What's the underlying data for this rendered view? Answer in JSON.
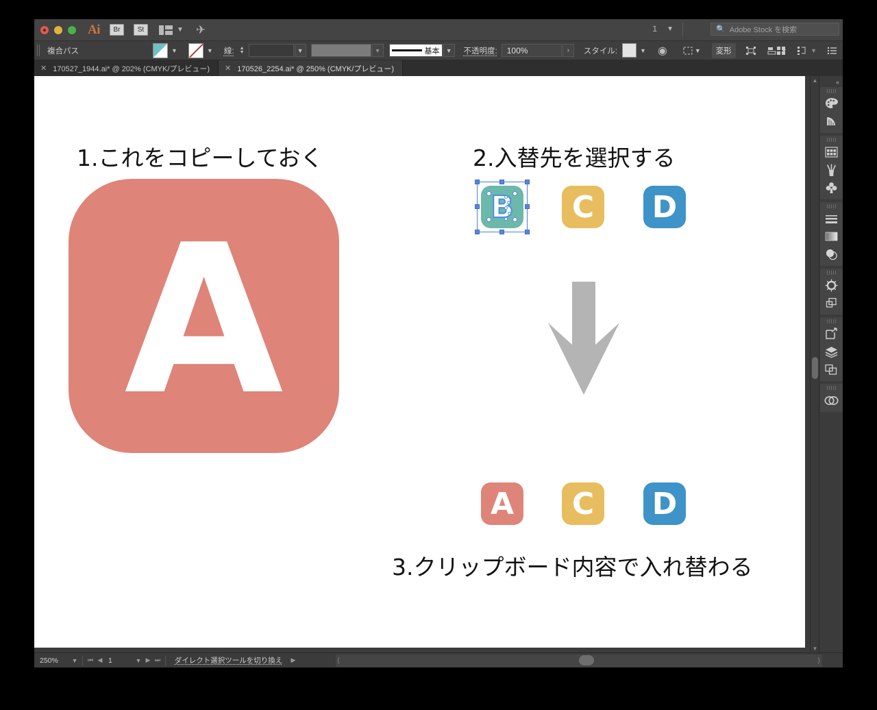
{
  "window": {
    "app_name": "Ai",
    "traffic_lights": [
      "close",
      "minimize",
      "zoom"
    ],
    "bridge_label": "Br",
    "stock_label": "St",
    "arrange_icon": "arrange-documents-icon",
    "sync_icon": "sync-settings-icon",
    "doc_count": "1",
    "search_placeholder": "Adobe Stock を検索",
    "search_icon": "search-icon"
  },
  "control_bar": {
    "object_type": "複合パス",
    "fill_label": "fill-swatch",
    "fill_color": "#6fc0c7",
    "stroke_swatch_label": "stroke-none-swatch",
    "stroke_label": "線:",
    "stroke_weight": "",
    "stroke_profile": "",
    "brush_definition": "基本",
    "opacity_label": "不透明度:",
    "opacity_value": "100%",
    "style_label": "スタイル:",
    "globe_icon": "recolor-artwork-icon",
    "select_similar_icon": "select-similar-icon",
    "transform_label": "変形",
    "isolate_icon": "isolate-group-icon",
    "align_icon": "align-objects-icon",
    "align_grid_icon": "align-grid-icon",
    "distribute_icon": "distribute-icon",
    "options_icon": "panel-options-icon"
  },
  "tabs": [
    {
      "title": "170527_1944.ai* @ 202% (CMYK/プレビュー)",
      "active": false,
      "close_icon": "close-tab-icon"
    },
    {
      "title": "170526_2254.ai* @ 250% (CMYK/プレビュー)",
      "active": true,
      "close_icon": "close-tab-icon"
    }
  ],
  "canvas": {
    "steps": {
      "step1": "1.これをコピーしておく",
      "step2": "2.入替先を選択する",
      "step3": "3.クリップボード内容で入れ替わる"
    },
    "source_tile": {
      "letter": "A",
      "color": "#de8479"
    },
    "target_row": [
      {
        "letter": "B",
        "color": "#6cb8ab",
        "selected": true
      },
      {
        "letter": "C",
        "color": "#e8bd5f",
        "selected": false
      },
      {
        "letter": "D",
        "color": "#3e93c8",
        "selected": false
      }
    ],
    "result_row": [
      {
        "letter": "A",
        "color": "#de8479",
        "selected": false
      },
      {
        "letter": "C",
        "color": "#e8bd5f",
        "selected": false
      },
      {
        "letter": "D",
        "color": "#3e93c8",
        "selected": false
      }
    ],
    "arrow_icon": "down-arrow-icon",
    "arrow_color": "#b4b4b4",
    "selection_color": "#5a86d8"
  },
  "panel_dock": {
    "collapse_icon": "collapse-panels-icon",
    "groups": [
      {
        "icons": [
          "color-icon",
          "color-guide-icon"
        ]
      },
      {
        "icons": [
          "swatches-icon",
          "brushes-icon",
          "symbols-icon"
        ]
      },
      {
        "icons": [
          "stroke-icon",
          "gradient-icon",
          "transparency-icon"
        ]
      },
      {
        "icons": [
          "appearance-icon",
          "graphic-styles-icon"
        ]
      },
      {
        "icons": [
          "artboards-icon",
          "layers-icon",
          "links-icon"
        ]
      },
      {
        "icons": [
          "creative-cloud-libraries-icon"
        ]
      }
    ]
  },
  "status_bar": {
    "zoom_level": "250%",
    "zoom_dropdown_icon": "chevron-down-icon",
    "first_page_icon": "first-page-icon",
    "prev_page_icon": "prev-page-icon",
    "page_number": "1",
    "page_dropdown_icon": "chevron-down-icon",
    "next_page_icon": "next-page-icon",
    "last_page_icon": "last-page-icon",
    "status_message": "ダイレクト選択ツールを切り換え",
    "status_menu_icon": "status-menu-icon",
    "scroll_left_icon": "scroll-left-icon",
    "scroll_right_icon": "scroll-right-icon"
  }
}
